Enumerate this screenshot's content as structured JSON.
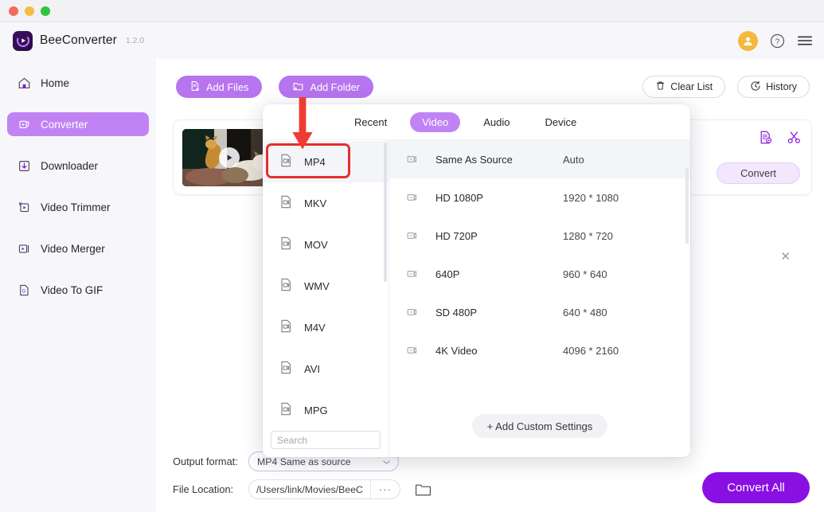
{
  "window": {
    "traffic_lights": [
      "close",
      "minimize",
      "maximize"
    ]
  },
  "header": {
    "brand": "BeeConverter",
    "version": "1.2.0",
    "avatar_icon": "user-avatar-icon",
    "help_icon": "question-circle-icon",
    "menu_icon": "hamburger-menu-icon"
  },
  "sidebar": {
    "items": [
      {
        "label": "Home",
        "icon": "home-icon",
        "active": false
      },
      {
        "label": "Converter",
        "icon": "converter-icon",
        "active": true
      },
      {
        "label": "Downloader",
        "icon": "download-icon",
        "active": false
      },
      {
        "label": "Video Trimmer",
        "icon": "trim-icon",
        "active": false
      },
      {
        "label": "Video Merger",
        "icon": "merge-icon",
        "active": false
      },
      {
        "label": "Video To GIF",
        "icon": "gif-icon",
        "active": false
      }
    ]
  },
  "toolbar": {
    "add_files": "Add Files",
    "add_files_icon": "file-plus-icon",
    "add_folder": "Add Folder",
    "add_folder_icon": "folder-plus-icon",
    "clear_list": "Clear List",
    "clear_list_icon": "trash-icon",
    "history": "History",
    "history_icon": "clock-history-icon"
  },
  "file_card": {
    "thumbnail_alt": "two cats on a patio video thumbnail",
    "play_icon": "play-icon",
    "settings_icon": "file-settings-icon",
    "cut_icon": "scissors-icon",
    "close_icon": "close-icon",
    "convert_label": "Convert"
  },
  "dropdown": {
    "tabs": [
      {
        "label": "Recent",
        "active": false
      },
      {
        "label": "Video",
        "active": true
      },
      {
        "label": "Audio",
        "active": false
      },
      {
        "label": "Device",
        "active": false
      }
    ],
    "formats": [
      {
        "label": "MP4",
        "icon": "video-file-icon",
        "selected": true
      },
      {
        "label": "MKV",
        "icon": "video-file-icon",
        "selected": false
      },
      {
        "label": "MOV",
        "icon": "video-file-icon",
        "selected": false
      },
      {
        "label": "WMV",
        "icon": "video-file-icon",
        "selected": false
      },
      {
        "label": "M4V",
        "icon": "video-file-icon",
        "selected": false
      },
      {
        "label": "AVI",
        "icon": "video-file-icon",
        "selected": false
      },
      {
        "label": "MPG",
        "icon": "video-file-icon",
        "selected": false
      }
    ],
    "search_placeholder": "Search",
    "search_value": "",
    "resolutions": [
      {
        "name": "Same As Source",
        "dimensions": "Auto",
        "icon": "video-res-icon",
        "selected": true
      },
      {
        "name": "HD 1080P",
        "dimensions": "1920 * 1080",
        "icon": "video-res-icon",
        "selected": false
      },
      {
        "name": "HD 720P",
        "dimensions": "1280 * 720",
        "icon": "video-res-icon",
        "selected": false
      },
      {
        "name": "640P",
        "dimensions": "960 * 640",
        "icon": "video-res-icon",
        "selected": false
      },
      {
        "name": "SD 480P",
        "dimensions": "640 * 480",
        "icon": "video-res-icon",
        "selected": false
      },
      {
        "name": "4K Video",
        "dimensions": "4096 * 2160",
        "icon": "video-res-icon",
        "selected": false
      }
    ],
    "add_custom": "+ Add Custom Settings"
  },
  "bottom": {
    "output_format_label": "Output format:",
    "output_format_value": "MP4 Same as source",
    "file_location_label": "File Location:",
    "file_location_value": "/Users/link/Movies/BeeC",
    "more_dots": "···",
    "folder_icon": "folder-open-icon",
    "convert_all": "Convert All"
  },
  "annotations": {
    "arrow_color": "#ef3c33",
    "highlight_color": "#e5302a"
  },
  "colors": {
    "accent": "#b674ee",
    "accent_strong": "#8a0fe3",
    "sidebar_active": "#c183f4",
    "sidebar_bg": "#f7f7fb"
  }
}
